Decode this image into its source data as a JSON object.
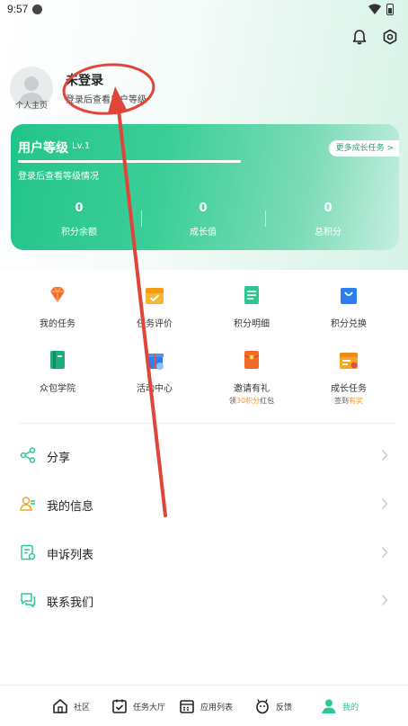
{
  "status_bar": {
    "time": "9:57"
  },
  "profile": {
    "avatar_label": "个人主页",
    "name": "未登录",
    "subtitle": "登录后查看用户等级"
  },
  "level_card": {
    "title": "用户等级",
    "level": "Lv.1",
    "more_button": "更多成长任务 >",
    "hint": "登录后查看等级情况",
    "progress": 1.0,
    "stats": [
      {
        "value": "0",
        "label": "积分余额"
      },
      {
        "value": "0",
        "label": "成长值"
      },
      {
        "value": "0",
        "label": "总积分"
      }
    ]
  },
  "grid": {
    "row1": [
      {
        "label": "我的任务",
        "icon": "diamond-icon"
      },
      {
        "label": "任务评价",
        "icon": "calendar-check-icon"
      },
      {
        "label": "积分明细",
        "icon": "document-icon"
      },
      {
        "label": "积分兑换",
        "icon": "shopping-bag-icon"
      }
    ],
    "row2": [
      {
        "label": "众包学院",
        "icon": "book-icon",
        "sub": ""
      },
      {
        "label": "活动中心",
        "icon": "gift-box-icon",
        "sub": ""
      },
      {
        "label": "邀请有礼",
        "icon": "red-envelope-icon",
        "sub_pre": "领",
        "sub_hl": "30积分",
        "sub_post": "红包"
      },
      {
        "label": "成长任务",
        "icon": "growth-calendar-icon",
        "sub_pre": "签到",
        "sub_hl": "有奖",
        "sub_post": ""
      }
    ]
  },
  "menu": [
    {
      "label": "分享",
      "icon": "share-icon"
    },
    {
      "label": "我的信息",
      "icon": "user-info-icon"
    },
    {
      "label": "申诉列表",
      "icon": "appeal-list-icon"
    },
    {
      "label": "联系我们",
      "icon": "chat-icon"
    }
  ],
  "tabbar": [
    {
      "label": "社区",
      "icon": "home-icon"
    },
    {
      "label": "任务大厅",
      "icon": "task-hall-icon"
    },
    {
      "label": "应用列表",
      "icon": "app-list-icon"
    },
    {
      "label": "反馈",
      "icon": "feedback-icon"
    },
    {
      "label": "我的",
      "icon": "profile-icon",
      "active": true
    }
  ],
  "colors": {
    "accent": "#2ec88f",
    "card_start": "#22c48a",
    "highlight": "#f29b38",
    "annotation": "#e0453a"
  }
}
